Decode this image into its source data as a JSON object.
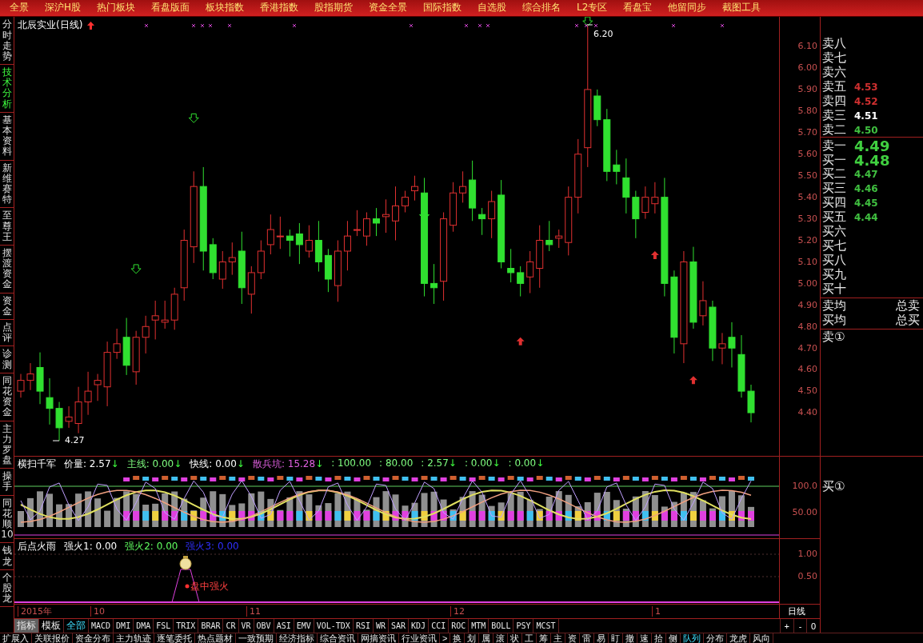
{
  "top_menu": [
    "全景",
    "深沪H股",
    "热门板块",
    "看盘版面",
    "板块指数",
    "香港指数",
    "股指期货",
    "资金全景",
    "国际指数",
    "自选股",
    "综合排名",
    "L2专区",
    "看盘宝",
    "他留同步",
    "截图工具"
  ],
  "sidebar": {
    "items": [
      {
        "label": "分时走势",
        "selected": false
      },
      {
        "label": "技术分析",
        "selected": true
      },
      {
        "label": "基本资料",
        "selected": false
      },
      {
        "label": "新维赛特",
        "selected": false
      },
      {
        "label": "至尊王",
        "selected": false
      },
      {
        "label": "摆渡资金",
        "selected": false
      },
      {
        "label": "资金",
        "selected": false
      },
      {
        "label": "点评",
        "selected": false
      },
      {
        "label": "诊测",
        "selected": false
      },
      {
        "label": "同花资金",
        "selected": false
      },
      {
        "label": "主力罗盘",
        "selected": false
      },
      {
        "label": "操手",
        "selected": false
      },
      {
        "label": "同花顺10",
        "selected": false
      },
      {
        "label": "钱龙",
        "selected": false
      },
      {
        "label": "个股龙",
        "selected": false
      }
    ]
  },
  "price_chart": {
    "title": "北辰实业(日线)",
    "high_label": "6.20",
    "low_label": "4.27",
    "axis_labels": [
      "6.10",
      "6.00",
      "5.90",
      "5.80",
      "5.70",
      "5.60",
      "5.50",
      "5.40",
      "5.30",
      "5.20",
      "5.10",
      "5.00",
      "4.90",
      "4.80",
      "4.70",
      "4.60",
      "4.50",
      "4.40"
    ]
  },
  "indicator_1": {
    "title": "横扫千军",
    "legend": [
      {
        "text": "价量: 2.57",
        "color": "#ffffff",
        "arrow": "↓"
      },
      {
        "text": "主线: 0.00",
        "color": "#80ff80",
        "arrow": "↓"
      },
      {
        "text": "快线: 0.00",
        "color": "#ffffff",
        "arrow": "↓"
      },
      {
        "text": "散兵坑: 15.28",
        "color": "#e060e0",
        "arrow": "↓"
      },
      {
        "text": ": 100.00",
        "color": "#80ff80"
      },
      {
        "text": ": 80.00",
        "color": "#80ff80"
      },
      {
        "text": ": 2.57",
        "color": "#80ff80",
        "arrow": "↓"
      },
      {
        "text": ": 0.00",
        "color": "#80ff80",
        "arrow": "↓"
      },
      {
        "text": ": 0.00",
        "color": "#80ff80",
        "arrow": "↓"
      }
    ],
    "axis_labels": [
      "100.0",
      "50.00"
    ]
  },
  "indicator_2": {
    "title": "后点火雨",
    "legend": [
      {
        "text": "强火1: 0.00",
        "color": "#ffffff"
      },
      {
        "text": "强火2: 0.00",
        "color": "#60ff60"
      },
      {
        "text": "强火3: 0.00",
        "color": "#3030ff"
      }
    ],
    "signal_label": "盘中强火",
    "axis_labels": [
      "1.00",
      "0.50"
    ]
  },
  "date_axis": {
    "labels": [
      "2015年",
      "10",
      "11",
      "12",
      "1"
    ],
    "period": "日线"
  },
  "indicator_tabs": [
    {
      "label": "指标",
      "kind": "view",
      "selected": true
    },
    {
      "label": "模板",
      "kind": "view",
      "selected": false
    },
    {
      "label": "全部",
      "kind": "filter",
      "selected": false
    },
    {
      "label": "MACD",
      "kind": "indicator",
      "selected": false
    },
    {
      "label": "DMI",
      "kind": "indicator",
      "selected": false
    },
    {
      "label": "DMA",
      "kind": "indicator",
      "selected": false
    },
    {
      "label": "FSL",
      "kind": "indicator",
      "selected": false
    },
    {
      "label": "TRIX",
      "kind": "indicator",
      "selected": false
    },
    {
      "label": "BRAR",
      "kind": "indicator",
      "selected": false
    },
    {
      "label": "CR",
      "kind": "indicator",
      "selected": false
    },
    {
      "label": "VR",
      "kind": "indicator",
      "selected": false
    },
    {
      "label": "OBV",
      "kind": "indicator",
      "selected": false
    },
    {
      "label": "ASI",
      "kind": "indicator",
      "selected": false
    },
    {
      "label": "EMV",
      "kind": "indicator",
      "selected": false
    },
    {
      "label": "VOL-TDX",
      "kind": "indicator",
      "selected": false
    },
    {
      "label": "RSI",
      "kind": "indicator",
      "selected": false
    },
    {
      "label": "WR",
      "kind": "indicator",
      "selected": false
    },
    {
      "label": "SAR",
      "kind": "indicator",
      "selected": false
    },
    {
      "label": "KDJ",
      "kind": "indicator",
      "selected": false
    },
    {
      "label": "CCI",
      "kind": "indicator",
      "selected": false
    },
    {
      "label": "ROC",
      "kind": "indicator",
      "selected": false
    },
    {
      "label": "MTM",
      "kind": "indicator",
      "selected": false
    },
    {
      "label": "BOLL",
      "kind": "indicator",
      "selected": false
    },
    {
      "label": "PSY",
      "kind": "indicator",
      "selected": false
    },
    {
      "label": "MCST",
      "kind": "indicator",
      "selected": false
    }
  ],
  "zoom_buttons": [
    "+",
    "-",
    "0"
  ],
  "order_book": {
    "rows": [
      {
        "label": "卖八"
      },
      {
        "label": "卖七"
      },
      {
        "label": "卖六"
      },
      {
        "label": "卖五",
        "price": "4.53",
        "color": "#d03030",
        "emphasized": false
      },
      {
        "label": "卖四",
        "price": "4.52",
        "color": "#d03030",
        "emphasized": false
      },
      {
        "label": "卖三",
        "price": "4.51",
        "color": "#ffffff",
        "emphasized": false
      },
      {
        "label": "卖二",
        "price": "4.50",
        "color": "#40c040",
        "emphasized": false
      },
      {
        "label": "卖一",
        "price": "4.49",
        "color": "#40d040",
        "emphasized": true
      },
      {
        "label": "买一",
        "price": "4.48",
        "color": "#40d040",
        "emphasized": true
      },
      {
        "label": "买二",
        "price": "4.47",
        "color": "#40c040",
        "emphasized": false
      },
      {
        "label": "买三",
        "price": "4.46",
        "color": "#40c040",
        "emphasized": false
      },
      {
        "label": "买四",
        "price": "4.45",
        "color": "#40c040",
        "emphasized": false
      },
      {
        "label": "买五",
        "price": "4.44",
        "color": "#40c040",
        "emphasized": false
      },
      {
        "label": "买六"
      },
      {
        "label": "买七"
      },
      {
        "label": "买八"
      },
      {
        "label": "买九"
      },
      {
        "label": "买十"
      }
    ],
    "summary": [
      {
        "left": "卖均",
        "right": "总卖"
      },
      {
        "left": "买均",
        "right": "总买"
      }
    ],
    "queue_sell": "卖①",
    "queue_buy": "买①"
  },
  "bottom_tabs": [
    {
      "label": "扩展入",
      "selected": false
    },
    {
      "label": "关联报价",
      "selected": false
    },
    {
      "label": "资金分布",
      "selected": false
    },
    {
      "label": "主力轨迹",
      "selected": false
    },
    {
      "label": "逐笔委托",
      "selected": false
    },
    {
      "label": "热点题材",
      "selected": false
    },
    {
      "label": "一致预期",
      "selected": false
    },
    {
      "label": "经济指标",
      "selected": false
    },
    {
      "label": "综合资讯",
      "selected": false
    },
    {
      "label": "网摘资讯",
      "selected": false
    },
    {
      "label": "行业资讯",
      "selected": false
    },
    {
      "label": ">",
      "selected": false
    },
    {
      "label": "换",
      "selected": false
    },
    {
      "label": "划",
      "selected": false
    },
    {
      "label": "属",
      "selected": false
    },
    {
      "label": "滚",
      "selected": false
    },
    {
      "label": "状",
      "selected": false
    },
    {
      "label": "工",
      "selected": false
    },
    {
      "label": "筹",
      "selected": false
    },
    {
      "label": "主",
      "selected": false
    },
    {
      "label": "资",
      "selected": false
    },
    {
      "label": "雷",
      "selected": false
    },
    {
      "label": "易",
      "selected": false
    },
    {
      "label": "盯",
      "selected": false
    },
    {
      "label": "撤",
      "selected": false
    },
    {
      "label": "速",
      "selected": false
    },
    {
      "label": "拾",
      "selected": false
    },
    {
      "label": "侧",
      "selected": false
    },
    {
      "label": "队列",
      "selected": true
    },
    {
      "label": "分布",
      "selected": false
    },
    {
      "label": "龙虎",
      "selected": false
    },
    {
      "label": "风向",
      "selected": false
    }
  ]
}
